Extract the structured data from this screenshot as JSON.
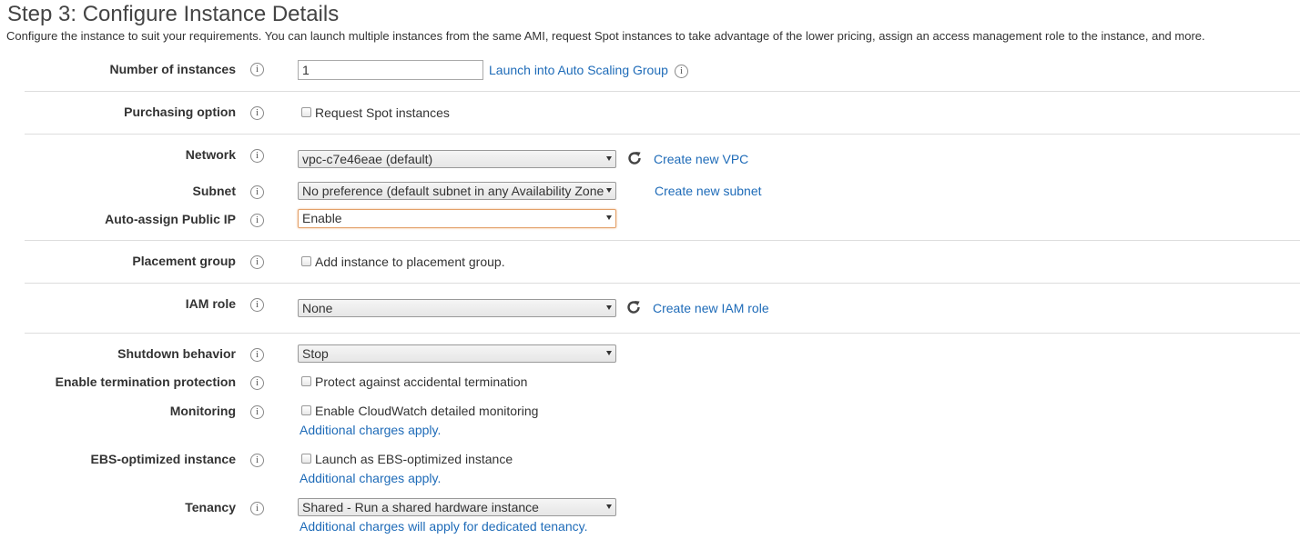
{
  "header": {
    "title": "Step 3: Configure Instance Details",
    "subtitle": "Configure the instance to suit your requirements. You can launch multiple instances from the same AMI, request Spot instances to take advantage of the lower pricing, assign an access management role to the instance, and more."
  },
  "info_glyph": "i",
  "fields": {
    "instances": {
      "label": "Number of instances",
      "value": "1",
      "link": "Launch into Auto Scaling Group"
    },
    "purchasing": {
      "label": "Purchasing option",
      "checkbox": "Request Spot instances",
      "checked": false
    },
    "network": {
      "label": "Network",
      "selected": "vpc-c7e46eae (default)",
      "link": "Create new VPC"
    },
    "subnet": {
      "label": "Subnet",
      "selected": "No preference (default subnet in any Availability Zone",
      "link": "Create new subnet"
    },
    "public_ip": {
      "label": "Auto-assign Public IP",
      "selected": "Enable"
    },
    "placement": {
      "label": "Placement group",
      "checkbox": "Add instance to placement group.",
      "checked": false
    },
    "iam": {
      "label": "IAM role",
      "selected": "None",
      "link": "Create new IAM role"
    },
    "shutdown": {
      "label": "Shutdown behavior",
      "selected": "Stop"
    },
    "termination": {
      "label": "Enable termination protection",
      "checkbox": "Protect against accidental termination",
      "checked": false
    },
    "monitoring": {
      "label": "Monitoring",
      "checkbox": "Enable CloudWatch detailed monitoring",
      "checked": false,
      "note": "Additional charges apply."
    },
    "ebs": {
      "label": "EBS-optimized instance",
      "checkbox": "Launch as EBS-optimized instance",
      "checked": false,
      "note": "Additional charges apply."
    },
    "tenancy": {
      "label": "Tenancy",
      "selected": "Shared - Run a shared hardware instance",
      "note": "Additional charges will apply for dedicated tenancy."
    }
  },
  "colors": {
    "link": "#1e6bb8",
    "focus_border": "#e3a16a"
  }
}
